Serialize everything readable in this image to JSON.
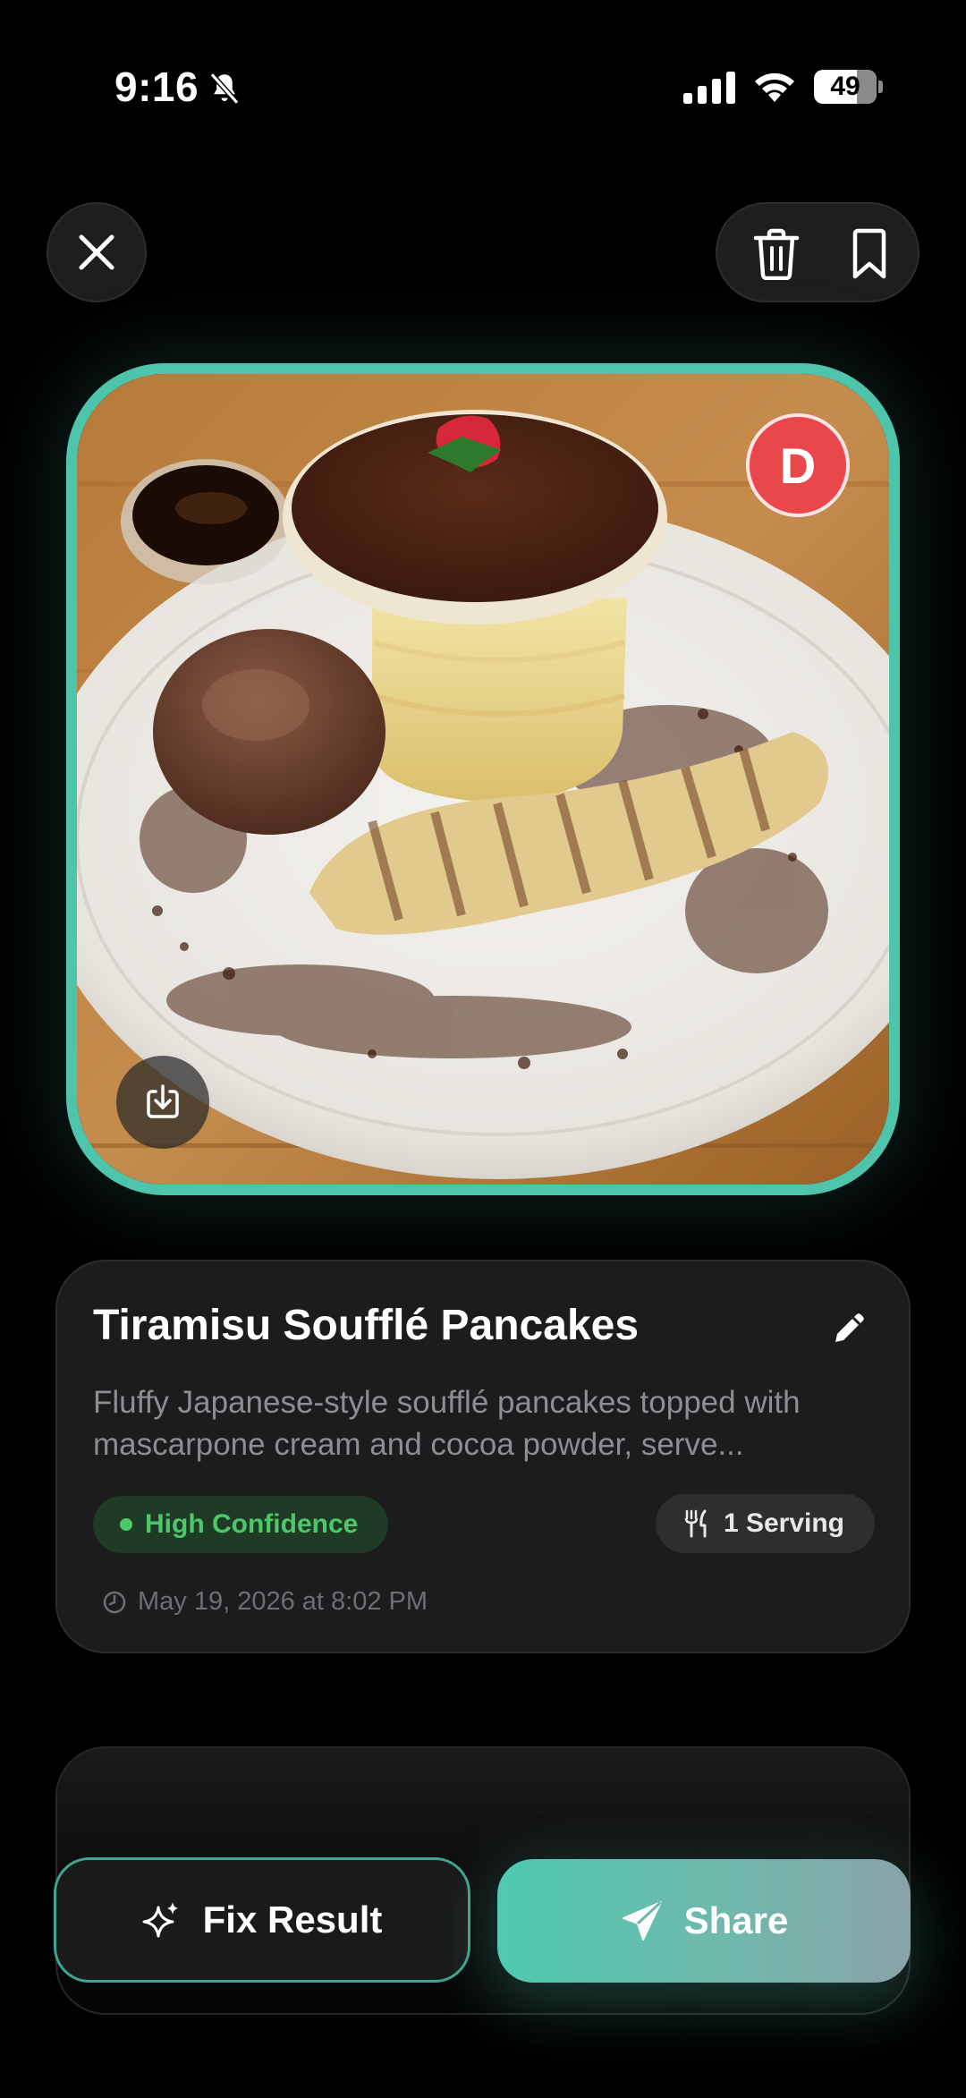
{
  "status_bar": {
    "time": "9:16",
    "battery_level": "49",
    "icons": [
      "mute-bell-icon",
      "cellular-signal-icon",
      "wifi-icon",
      "battery-icon"
    ]
  },
  "top_bar": {
    "icons": [
      "close-icon",
      "trash-icon",
      "bookmark-icon"
    ]
  },
  "photo": {
    "grade": "D",
    "border_color": "#4ec4aa",
    "grade_color": "#e9474b",
    "icons": [
      "download-icon"
    ]
  },
  "meal": {
    "title": "Tiramisu Soufflé Pancakes",
    "description": "Fluffy Japanese-style soufflé pancakes topped with mascarpone cream and cocoa powder, serve...",
    "confidence": "High Confidence",
    "confidence_color": "#4cc76a",
    "servings": "1 Serving",
    "timestamp": "May 19, 2026 at 8:02 PM",
    "icons": [
      "pencil-icon",
      "fork-knife-icon",
      "clock-icon"
    ]
  },
  "actions": {
    "fix_label": "Fix Result",
    "share_label": "Share",
    "accent": "#4fcab0",
    "icons": [
      "sparkles-icon",
      "paper-plane-icon"
    ]
  }
}
